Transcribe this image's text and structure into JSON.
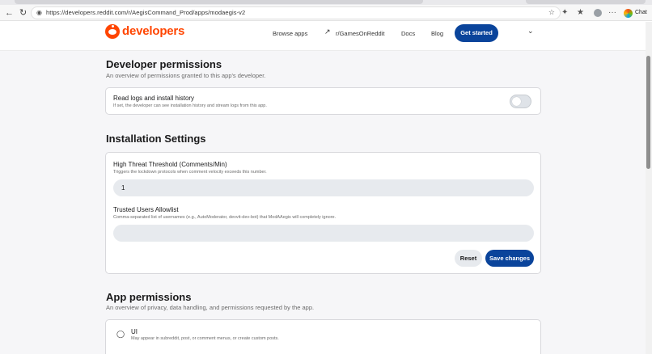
{
  "browser": {
    "url": "https://developers.reddit.com/r/AegisCommand_Prod/apps/modaegis-v2",
    "chat_label": "Chat"
  },
  "nav": {
    "brand": "developers",
    "browse_apps": "Browse apps",
    "subreddit_link": "r/GamesOnReddit",
    "docs": "Docs",
    "blog": "Blog",
    "get_started": "Get started"
  },
  "developer_permissions": {
    "title": "Developer permissions",
    "subtitle": "An overview of permissions granted to this app's developer.",
    "items": [
      {
        "title": "Read logs and install history",
        "description": "If set, the developer can see installation history and stream logs from this app.",
        "enabled": false
      }
    ]
  },
  "installation_settings": {
    "title": "Installation Settings",
    "fields": [
      {
        "label": "High Threat Threshold (Comments/Min)",
        "help": "Triggers the lockdown protocols when comment velocity exceeds this number.",
        "value": "1"
      },
      {
        "label": "Trusted Users Allowlist",
        "help": "Comma-separated list of usernames (e.g., AutoModerator, devvit-dev-bot) that ModAAegis will completely ignore.",
        "value": ""
      }
    ],
    "reset_label": "Reset",
    "save_label": "Save changes"
  },
  "app_permissions": {
    "title": "App permissions",
    "subtitle": "An overview of privacy, data handling, and permissions requested by the app.",
    "items": [
      {
        "icon": "tag-icon",
        "title": "UI",
        "description": "May appear in subreddit, post, or comment menus, or create custom posts."
      }
    ]
  },
  "colors": {
    "brand": "#ff4500",
    "primary_button": "#0a449b"
  }
}
